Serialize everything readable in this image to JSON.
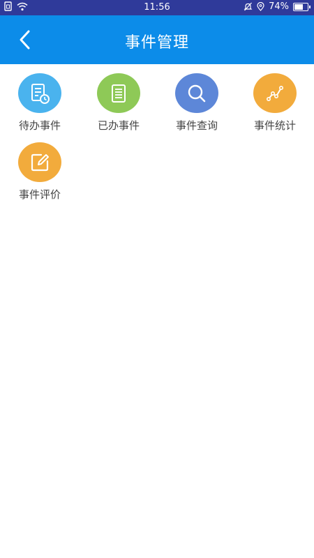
{
  "status_bar": {
    "time": "11:56",
    "battery": "74%",
    "battery_level": 0.74
  },
  "header": {
    "title": "事件管理",
    "back_icon": "chevron-left-icon"
  },
  "colors": {
    "status_bar": "#2f3a9a",
    "header": "#0c8ce9",
    "pending": "#4ab3ee",
    "done": "#8ec957",
    "query": "#5d87d8",
    "stats": "#f2ab3c",
    "evaluate": "#f2ab3c"
  },
  "menu": {
    "items": [
      {
        "label": "待办事件",
        "icon": "pending-document-icon"
      },
      {
        "label": "已办事件",
        "icon": "document-icon"
      },
      {
        "label": "事件查询",
        "icon": "search-icon"
      },
      {
        "label": "事件统计",
        "icon": "line-chart-icon"
      },
      {
        "label": "事件评价",
        "icon": "edit-icon"
      }
    ]
  }
}
